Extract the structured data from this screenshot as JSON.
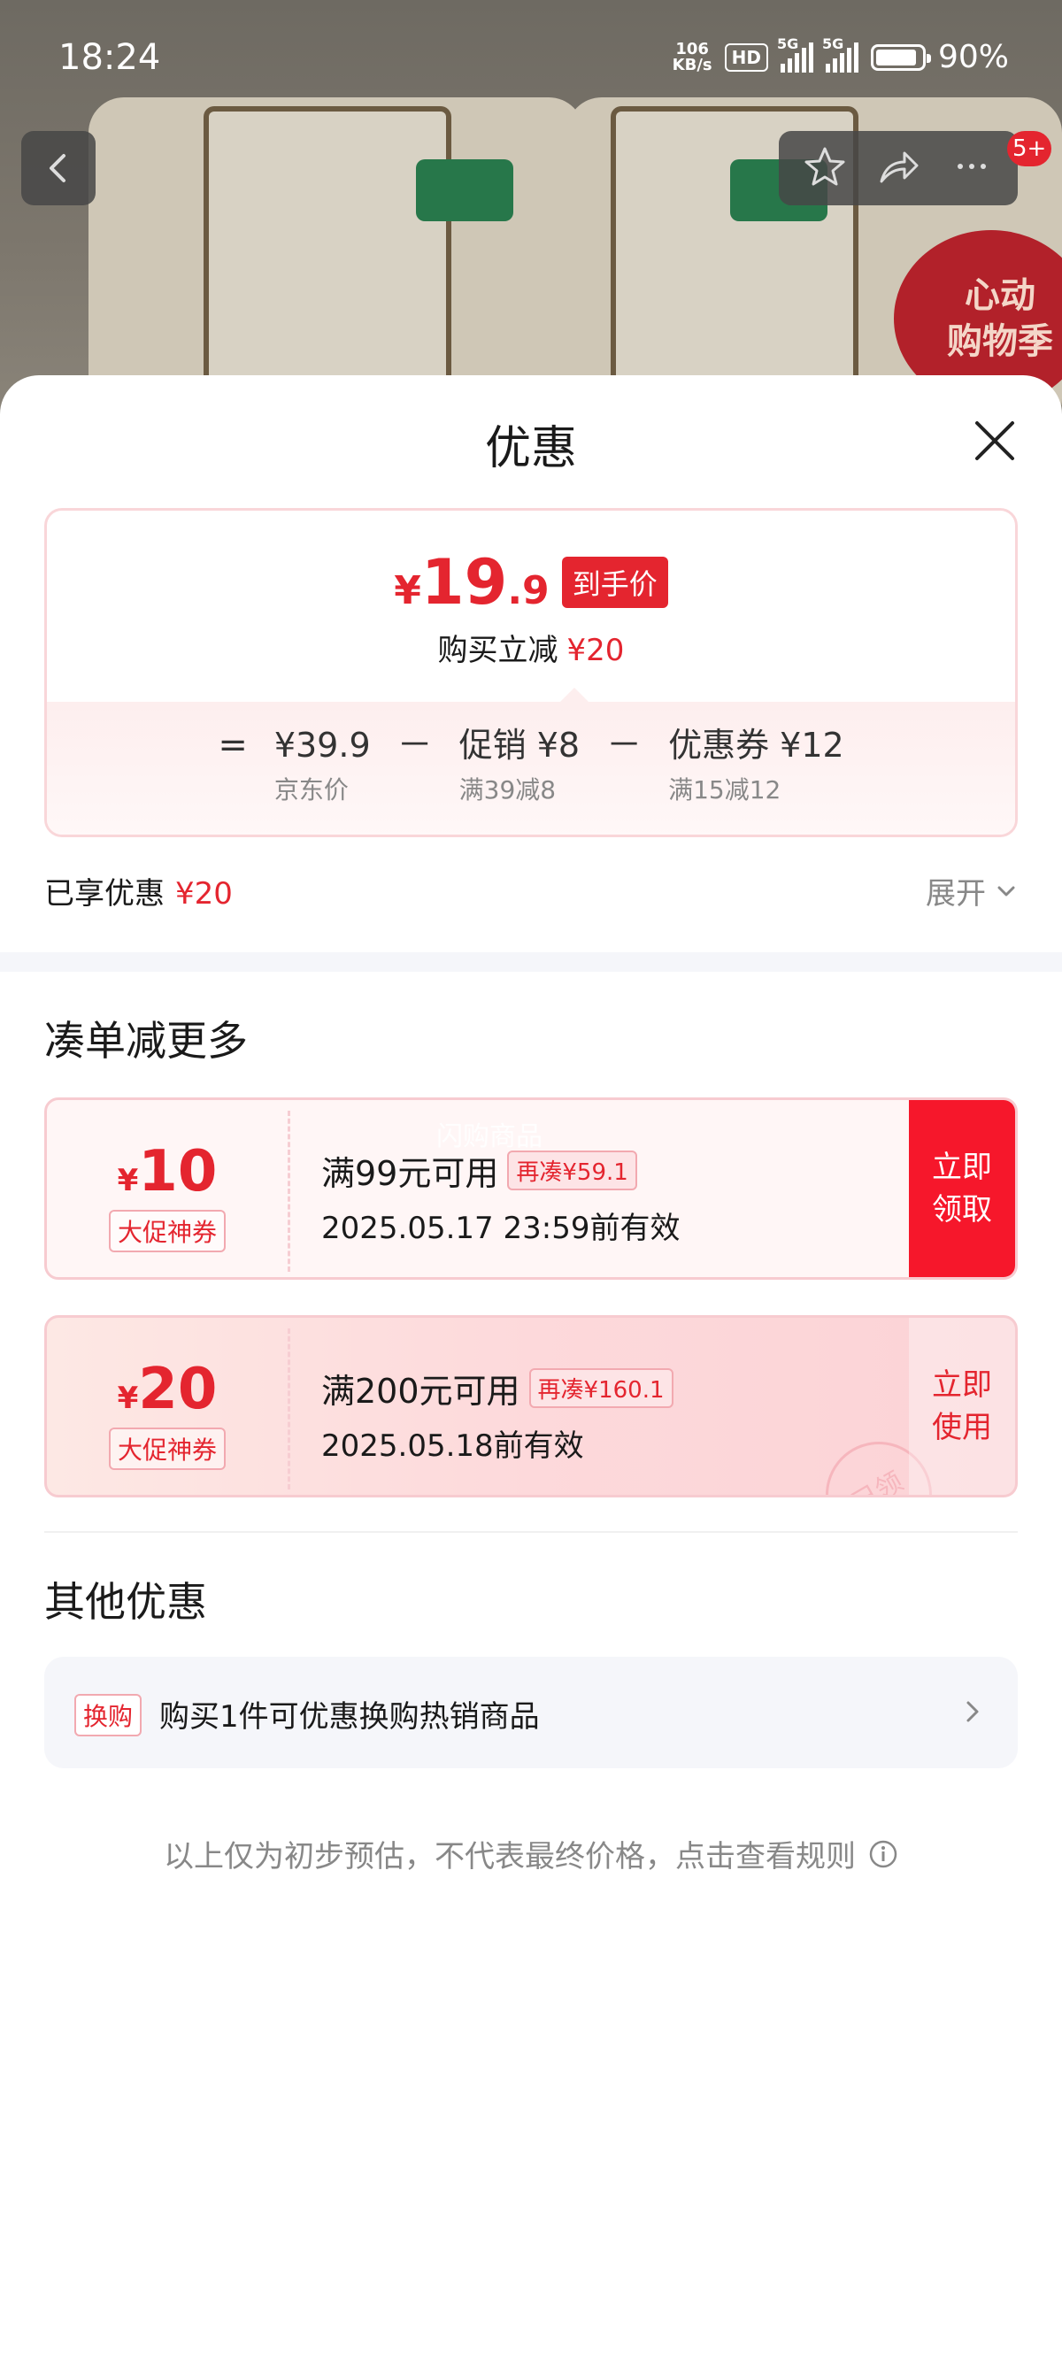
{
  "status_bar": {
    "time": "18:24",
    "net_speed_value": "106",
    "net_speed_unit": "KB/s",
    "hd_badge": "HD",
    "signal1_label": "5G",
    "signal2_label": "5G",
    "battery_percent": "90%",
    "battery_level": 0.9
  },
  "product_banner": {
    "promo_line1": "心动",
    "promo_line2": "购物季"
  },
  "nav": {
    "cart_badge": "5+"
  },
  "sheet": {
    "title": "优惠"
  },
  "price_card": {
    "currency": "¥",
    "price_int": "19",
    "price_dec": ".9",
    "price_tag": "到手价",
    "reduction_label": "购买立减",
    "reduction_value": "¥20",
    "equals": "=",
    "minus": "－",
    "terms": [
      {
        "main": "¥39.9",
        "sub": "京东价"
      },
      {
        "main": "促销 ¥8",
        "sub": "满39减8"
      },
      {
        "main": "优惠券 ¥12",
        "sub": "满15减12"
      }
    ]
  },
  "enjoyed": {
    "label": "已享优惠",
    "value": "¥20",
    "expand_label": "展开"
  },
  "more_section": {
    "title": "凑单减更多",
    "coupons": [
      {
        "yen": "¥",
        "amount": "10",
        "label": "大促神券",
        "condition": "满99元可用",
        "more": "再凑¥59.1",
        "validity": "2025.05.17 23:59前有效",
        "button_line1": "立即",
        "button_line2": "领取",
        "watermark": "闪购商品"
      },
      {
        "yen": "¥",
        "amount": "20",
        "label": "大促神券",
        "condition": "满200元可用",
        "more": "再凑¥160.1",
        "validity": "2025.05.18前有效",
        "button_line1": "立即",
        "button_line2": "使用",
        "stamp": "已领"
      }
    ]
  },
  "other_section": {
    "title": "其他优惠",
    "item_tag": "换购",
    "item_text": "购买1件可优惠换购热销商品"
  },
  "footnote": "以上仅为初步预估，不代表最终价格，点击查看规则",
  "colors": {
    "accent_red": "#e4252f",
    "button_red": "#f6172b"
  }
}
